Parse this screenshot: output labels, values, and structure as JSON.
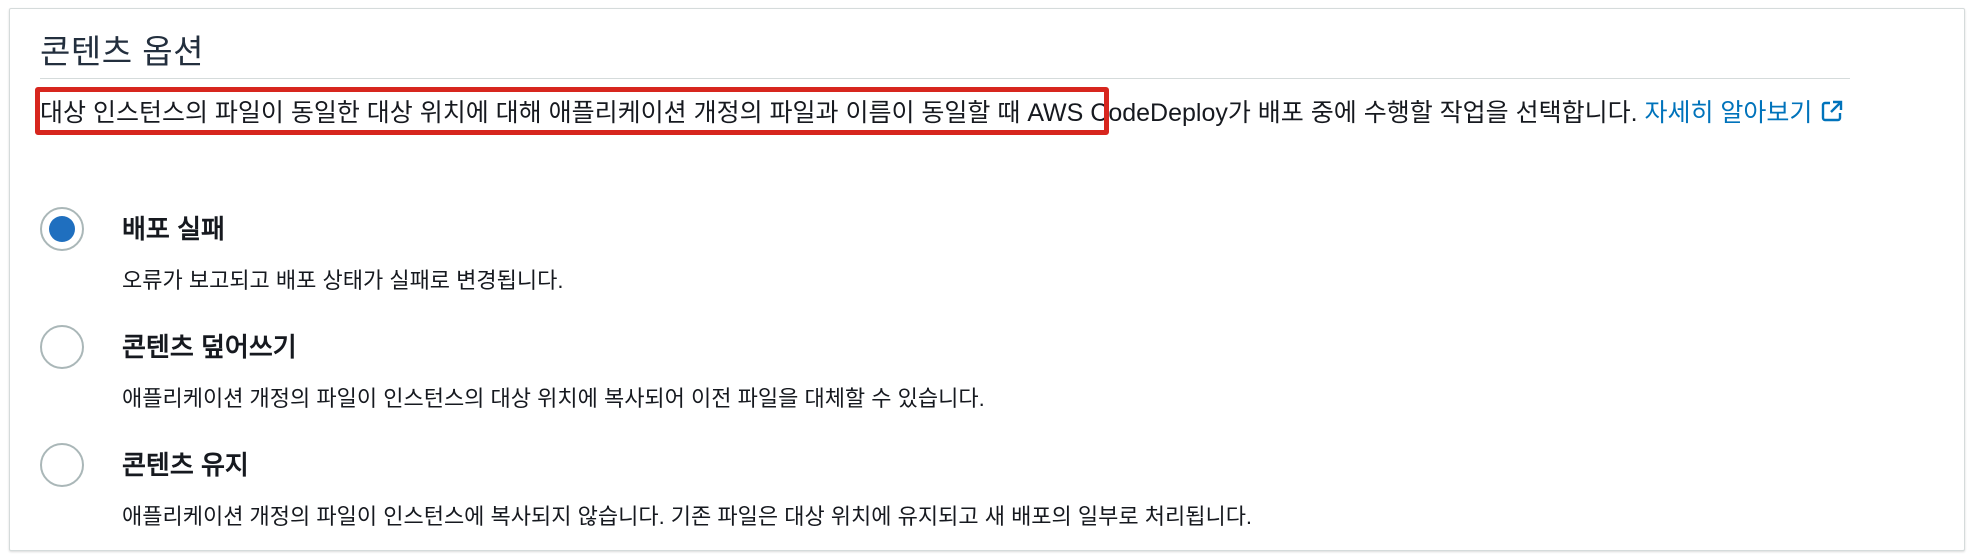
{
  "section": {
    "title": "콘텐츠 옵션"
  },
  "description": {
    "highlighted_text": "대상 인스턴스의 파일이 동일한 대상 위치에 대해 애플리케이션 개정의 파일과 이름이 동일할 때 ",
    "rest_text": "AWS CodeDeploy가 배포 중에 수행할 작업을 선택합니다. ",
    "link_text": "자세히 알아보기",
    "link_icon": "external-link-icon"
  },
  "options": [
    {
      "label": "배포 실패",
      "description": "오류가 보고되고 배포 상태가 실패로 변경됩니다.",
      "checked": true
    },
    {
      "label": "콘텐츠 덮어쓰기",
      "description": "애플리케이션 개정의 파일이 인스턴스의 대상 위치에 복사되어 이전 파일을 대체할 수 있습니다.",
      "checked": false
    },
    {
      "label": "콘텐츠 유지",
      "description": "애플리케이션 개정의 파일이 인스턴스에 복사되지 않습니다. 기존 파일은 대상 위치에 유지되고 새 배포의 일부로 처리됩니다.",
      "checked": false
    }
  ],
  "colors": {
    "accent_radio": "#1f6fbf",
    "link": "#0073bb",
    "highlight_border": "#d7261e"
  }
}
